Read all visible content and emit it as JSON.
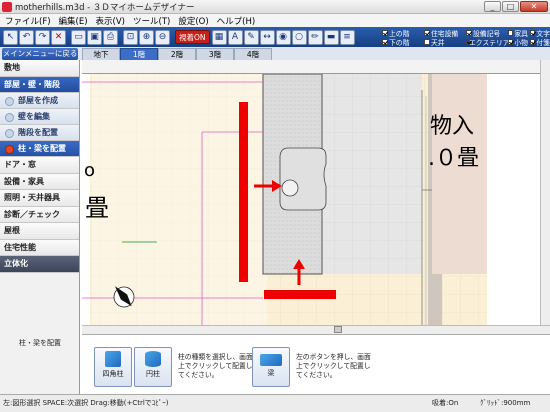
{
  "window": {
    "title": "motherhills.m3d - ３Ｄマイホームデザイナー",
    "btn_min": "_",
    "btn_max": "□",
    "btn_close": "✕"
  },
  "menu": [
    "ファイル(F)",
    "編集(E)",
    "表示(V)",
    "ツール(T)",
    "設定(O)",
    "ヘルプ(H)"
  ],
  "toolbar": {
    "toggle_label": "視着ON"
  },
  "checks": [
    {
      "label": "上の階",
      "on": true
    },
    {
      "label": "住宅設備",
      "on": true
    },
    {
      "label": "設備記号",
      "on": true
    },
    {
      "label": "家具",
      "on": false
    },
    {
      "label": "下の階",
      "on": true
    },
    {
      "label": "天井",
      "on": false
    },
    {
      "label": "エクステリア",
      "on": true
    },
    {
      "label": "小物",
      "on": true
    }
  ],
  "checks_extra": [
    {
      "label": "文字",
      "on": true
    },
    {
      "label": "付箋",
      "on": true
    }
  ],
  "back_button": "メインメニューに戻る",
  "floor_tabs": [
    {
      "label": "地下",
      "active": false
    },
    {
      "label": "1階",
      "active": true
    },
    {
      "label": "2階",
      "active": false
    },
    {
      "label": "3階",
      "active": false
    },
    {
      "label": "4階",
      "active": false
    }
  ],
  "sidebar": {
    "shikichi": "敷地",
    "heya": "部屋・壁・階段",
    "subs": [
      "部屋を作成",
      "壁を編集",
      "階段を配置",
      "柱・梁を配置"
    ],
    "others": [
      "ドア・窓",
      "設備・家具",
      "照明・天井器具",
      "診断／チェック",
      "屋根",
      "住宅性能"
    ],
    "rittaika": "立体化",
    "panel_label": "柱・梁を配置"
  },
  "canvas": {
    "room_text_1": "物入",
    "room_text_2": ".０畳",
    "room_text_left": "畳",
    "room_text_left2": "o"
  },
  "bottom": {
    "btn_square": "四角柱",
    "btn_round": "円柱",
    "note1": "柱の種類を選択し、画面上でクリックして配置してください。",
    "btn_beam": "梁",
    "note2": "左のボタンを押し、画面上でクリックして配置してください。"
  },
  "status": {
    "left": "左:図形選択 SPACE:次選択 Drag:移動(+Ctrlでｺﾋﾟｰ)",
    "snap": "吸着:On",
    "grid": "ｸﾞﾘｯﾄﾞ:900mm"
  },
  "colors": {
    "accent": "#2350a8",
    "annotation_red": "#ee0000",
    "floor": "#fbf0d5"
  }
}
